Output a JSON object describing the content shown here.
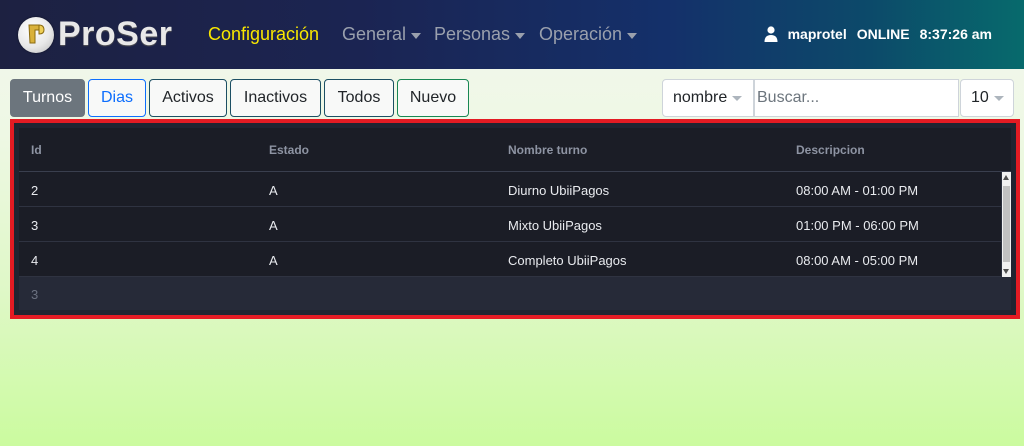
{
  "brand": {
    "name": "ProSer"
  },
  "nav": {
    "items": [
      {
        "label": "Configuración",
        "active": true
      },
      {
        "label": "General",
        "dropdown": true
      },
      {
        "label": "Personas",
        "dropdown": true
      },
      {
        "label": "Operación",
        "dropdown": true
      }
    ]
  },
  "user": {
    "username": "maprotel",
    "status": "ONLINE",
    "time": "8:37:26 am"
  },
  "toolbar": {
    "tabs": [
      "Turnos",
      "Dias",
      "Activos",
      "Inactivos",
      "Todos",
      "Nuevo"
    ],
    "filter_field": "nombre",
    "search_placeholder": "Buscar...",
    "rows_per_page": "10"
  },
  "table": {
    "columns": [
      "Id",
      "Estado",
      "Nombre turno",
      "Descripcion"
    ],
    "rows": [
      [
        "2",
        "A",
        "Diurno UbiiPagos",
        "08:00 AM - 01:00 PM"
      ],
      [
        "3",
        "A",
        "Mixto UbiiPagos",
        "01:00 PM - 06:00 PM"
      ],
      [
        "4",
        "A",
        "Completo UbiiPagos",
        "08:00 AM - 05:00 PM"
      ]
    ],
    "footer_count": "3"
  },
  "colors": {
    "nav_active": "#f8e600",
    "highlight_border": "#e31b23",
    "table_bg": "#1b1d26"
  }
}
